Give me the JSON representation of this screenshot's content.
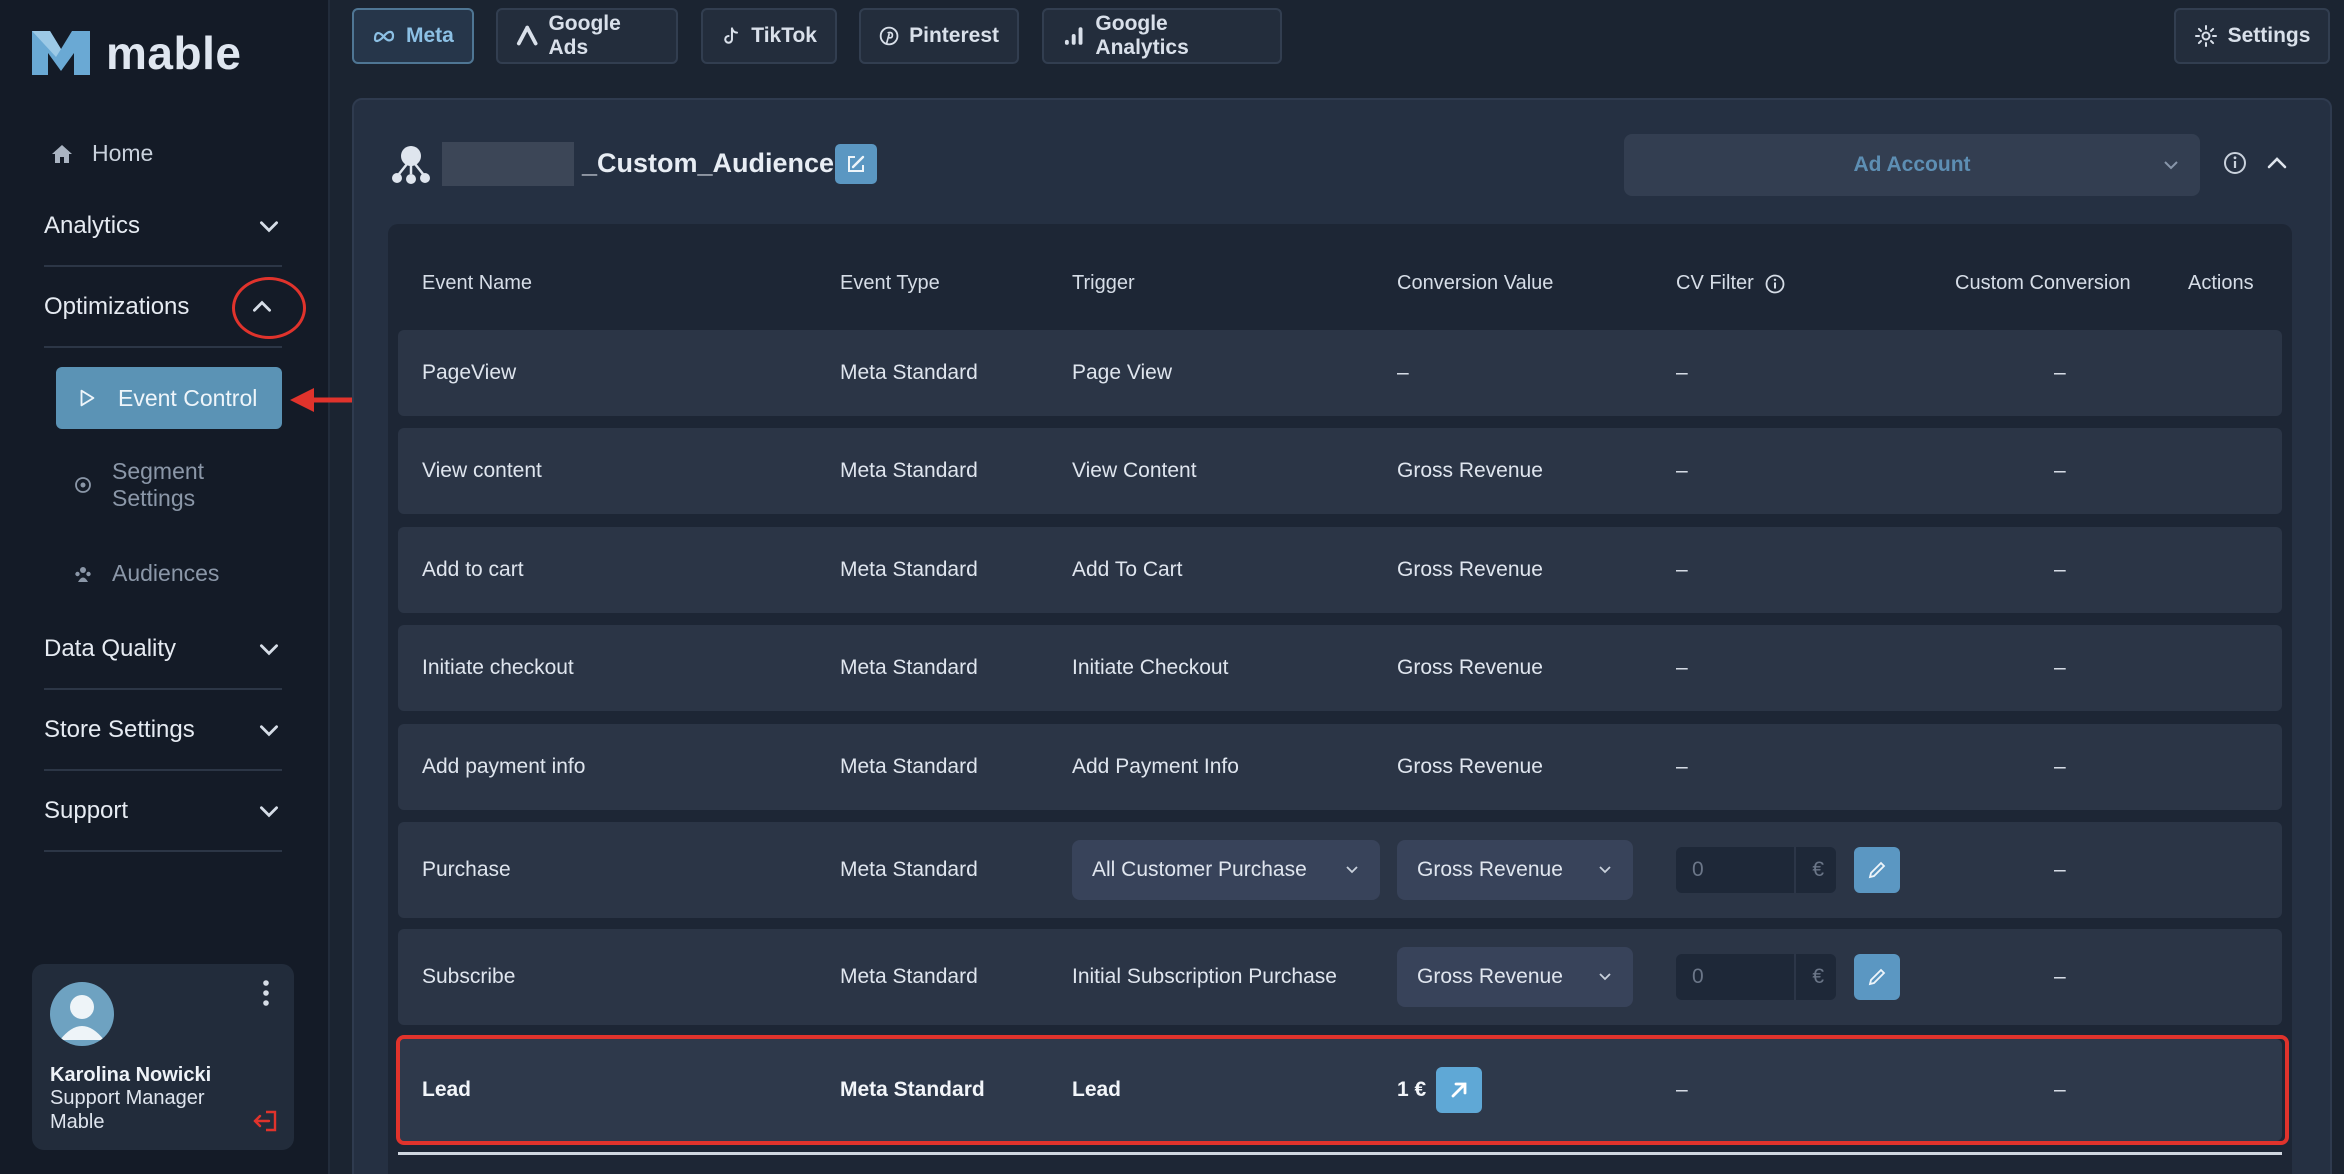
{
  "app": {
    "name": "mable"
  },
  "sidebar": {
    "home": "Home",
    "analytics": "Analytics",
    "optimizations": "Optimizations",
    "sub_items": {
      "event_control": "Event Control",
      "segment_settings": "Segment Settings",
      "audiences": "Audiences"
    },
    "data_quality": "Data Quality",
    "store_settings": "Store Settings",
    "support": "Support",
    "user": {
      "name": "Karolina Nowicki",
      "role": "Support Manager Mable"
    }
  },
  "tabs": [
    {
      "label": "Meta",
      "icon": "meta-icon"
    },
    {
      "label": "Google Ads",
      "icon": "google-ads-icon"
    },
    {
      "label": "TikTok",
      "icon": "tiktok-icon"
    },
    {
      "label": "Pinterest",
      "icon": "pinterest-icon"
    },
    {
      "label": "Google Analytics",
      "icon": "google-analytics-icon"
    }
  ],
  "settings_label": "Settings",
  "panel": {
    "title": "_Custom_Audience",
    "ad_account_placeholder": "Ad Account"
  },
  "table": {
    "headers": {
      "event_name": "Event Name",
      "event_type": "Event Type",
      "trigger": "Trigger",
      "conversion_value": "Conversion Value",
      "cv_filter": "CV Filter",
      "custom_conversion": "Custom Conversion",
      "actions": "Actions"
    },
    "rows": [
      {
        "name": "PageView",
        "type": "Meta Standard",
        "trigger": "Page View",
        "cv": "–",
        "filter": "–",
        "custom": "–"
      },
      {
        "name": "View content",
        "type": "Meta Standard",
        "trigger": "View Content",
        "cv": "Gross Revenue",
        "filter": "–",
        "custom": "–"
      },
      {
        "name": "Add to cart",
        "type": "Meta Standard",
        "trigger": "Add To Cart",
        "cv": "Gross Revenue",
        "filter": "–",
        "custom": "–"
      },
      {
        "name": "Initiate checkout",
        "type": "Meta Standard",
        "trigger": "Initiate Checkout",
        "cv": "Gross Revenue",
        "filter": "–",
        "custom": "–"
      },
      {
        "name": "Add payment info",
        "type": "Meta Standard",
        "trigger": "Add Payment Info",
        "cv": "Gross Revenue",
        "filter": "–",
        "custom": "–"
      },
      {
        "name": "Purchase",
        "type": "Meta Standard",
        "trigger": "All Customer Purchase",
        "cv": "Gross Revenue",
        "filter_value": "0",
        "currency": "€",
        "custom": "–"
      },
      {
        "name": "Subscribe",
        "type": "Meta Standard",
        "trigger": "Initial Subscription Purchase",
        "cv": "Gross Revenue",
        "filter_value": "0",
        "currency": "€",
        "custom": "–"
      },
      {
        "name": "Lead",
        "type": "Meta Standard",
        "trigger": "Lead",
        "cv": "1 €",
        "filter": "–",
        "custom": "–"
      }
    ]
  },
  "colors": {
    "accent": "#5b97c2",
    "annotation": "#e0332c",
    "background": "#1b2431"
  }
}
